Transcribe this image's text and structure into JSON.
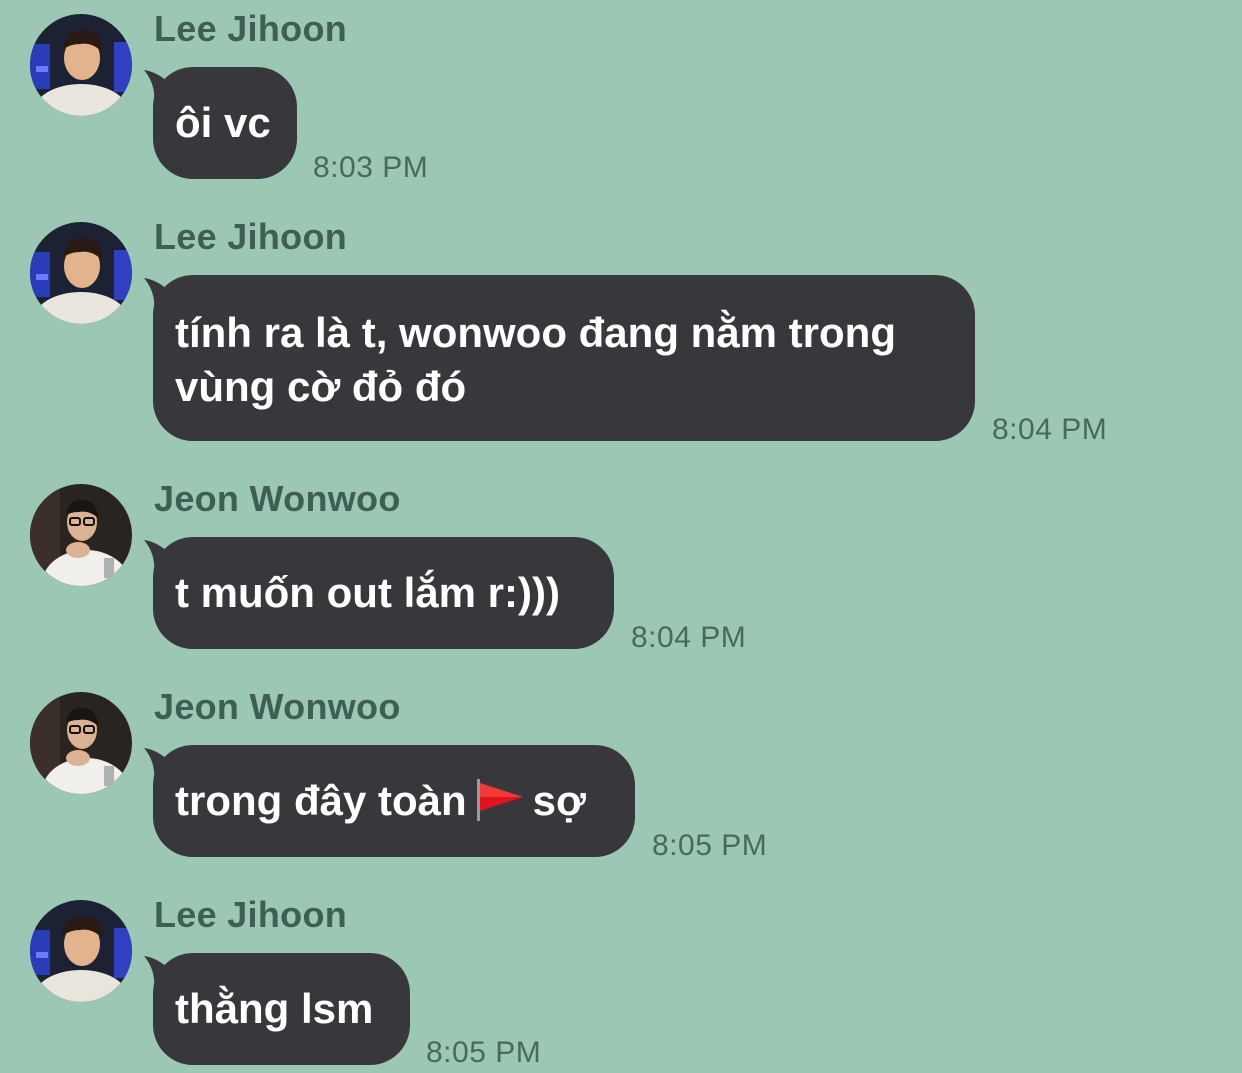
{
  "messages": [
    {
      "sender": "Lee Jihoon",
      "text": "ôi vc",
      "time": "8:03 PM",
      "avatar": "avatar-lee-jihoon"
    },
    {
      "sender": "Lee Jihoon",
      "text_line1": "tính ra là t, wonwoo đang nằm trong",
      "text_line2": "vùng cờ đỏ đó",
      "time": "8:04 PM",
      "avatar": "avatar-lee-jihoon"
    },
    {
      "sender": "Jeon Wonwoo",
      "text": "t muốn out lắm r:)))",
      "time": "8:04 PM",
      "avatar": "avatar-jeon-wonwoo"
    },
    {
      "sender": "Jeon Wonwoo",
      "text_before": "trong đây toàn",
      "icon": "red-flag-icon",
      "text_after": "sợ",
      "time": "8:05 PM",
      "avatar": "avatar-jeon-wonwoo"
    },
    {
      "sender": "Lee Jihoon",
      "text": "thằng lsm",
      "time": "8:05 PM",
      "avatar": "avatar-lee-jihoon"
    }
  ],
  "colors": {
    "background": "#9cc7b5",
    "bubble": "#38383c",
    "sender_text": "#3f5f52",
    "time_text": "#476a5c"
  }
}
